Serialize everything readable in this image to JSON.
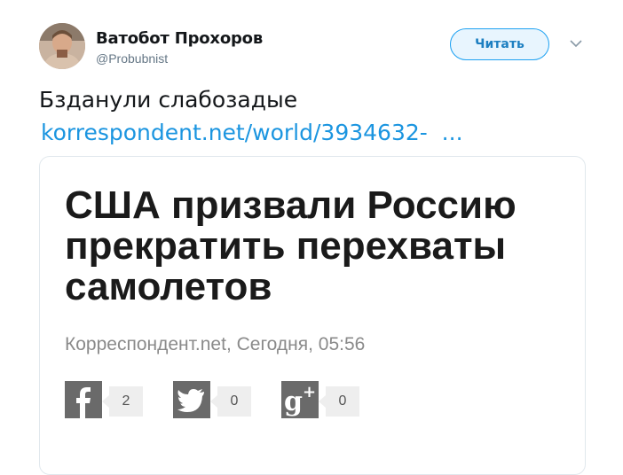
{
  "author": {
    "name": "Ватобот Прохоров",
    "handle": "@Probubnist"
  },
  "follow_button": "Читать",
  "tweet": {
    "text": "Бзданули слабозадые",
    "link": "korrespondent.net/world/3934632-  ..."
  },
  "card": {
    "headline": "США призвали Россию прекратить перехваты самолетов",
    "meta": "Корреспондент.net, Сегодня, 05:56",
    "shares": [
      {
        "network": "facebook",
        "icon": "facebook-icon",
        "count": "2"
      },
      {
        "network": "twitter",
        "icon": "twitter-icon",
        "count": "0"
      },
      {
        "network": "google-plus",
        "icon": "google-plus-icon",
        "count": "0"
      }
    ]
  }
}
